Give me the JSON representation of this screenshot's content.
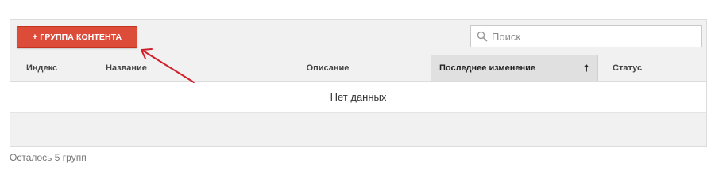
{
  "toolbar": {
    "add_plus": "+",
    "add_label": "ГРУППА КОНТЕНТА",
    "search_placeholder": "Поиск",
    "search_value": ""
  },
  "table": {
    "columns": [
      {
        "label": "Индекс"
      },
      {
        "label": "Название"
      },
      {
        "label": "Описание"
      },
      {
        "label": "Последнее изменение",
        "sorted": true,
        "sort_direction": "ascending"
      },
      {
        "label": "Статус"
      }
    ],
    "empty_message": "Нет данных"
  },
  "footer": {
    "remaining_text": "Осталось 5 групп"
  },
  "colors": {
    "accent_button": "#dd4b39",
    "annotation_arrow": "#d0202a",
    "header_bg": "#f1f1f1",
    "sorted_header_bg": "#e0e0e0"
  },
  "icons": {
    "search": "search-icon",
    "sort": "sort-up-arrow-icon"
  }
}
